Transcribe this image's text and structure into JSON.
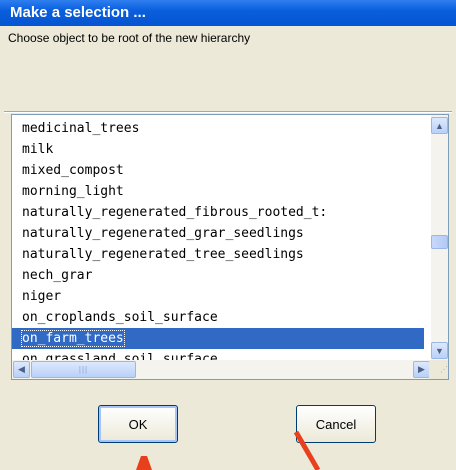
{
  "dialog": {
    "title": "Make a selection ...",
    "prompt": "Choose object to be root of the new hierarchy"
  },
  "list": {
    "items": [
      "medicinal_trees",
      "milk",
      "mixed_compost",
      "morning_light",
      "naturally_regenerated_fibrous_rooted_t:",
      "naturally_regenerated_grar_seedlings",
      "naturally_regenerated_tree_seedlings",
      "nech_grar",
      "niger",
      "on_croplands_soil_surface",
      "on_farm_trees",
      "on_grassland_soil_surface"
    ],
    "selected": "on_farm_trees"
  },
  "buttons": {
    "ok": "OK",
    "cancel": "Cancel"
  },
  "colors": {
    "titlebar": "#0654d1",
    "selection": "#316ac5",
    "annotation_arrow": "#e8401c"
  },
  "icons": {
    "scroll_up": "triangle-up-icon",
    "scroll_down": "triangle-down-icon",
    "scroll_left": "triangle-left-icon",
    "scroll_right": "triangle-right-icon"
  }
}
